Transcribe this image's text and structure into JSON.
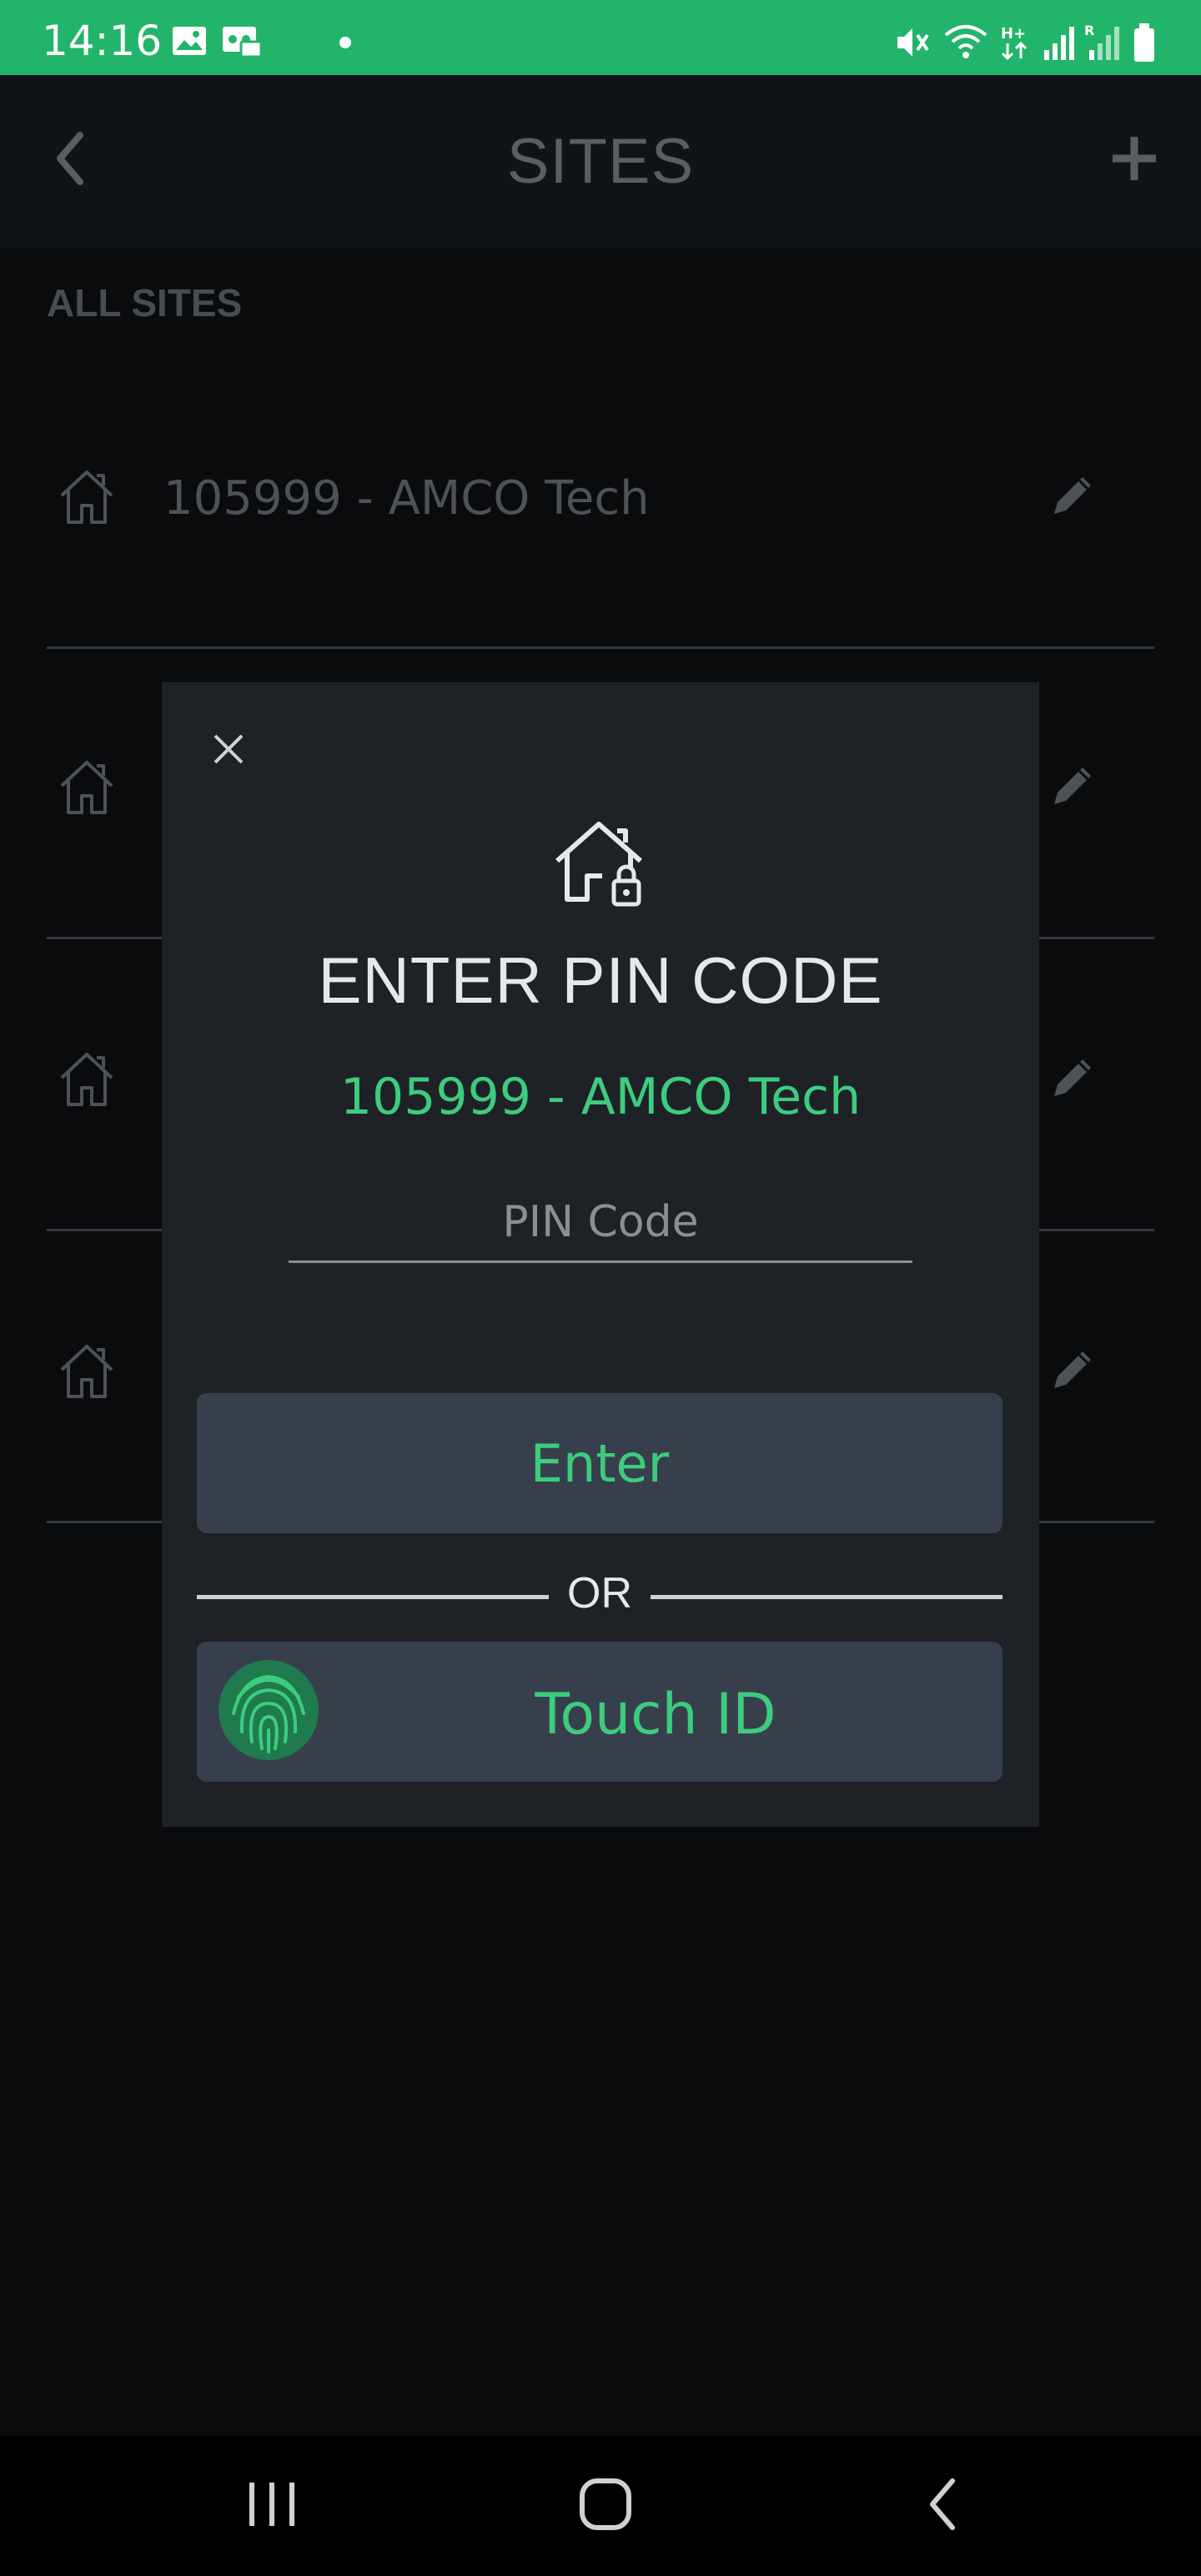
{
  "status_bar": {
    "time": "14:16",
    "icons": [
      "image-icon",
      "voicemail-icon",
      "mute-icon",
      "wifi-icon",
      "hplus-icon",
      "signal-icon",
      "roaming-signal-icon",
      "battery-icon"
    ],
    "bg_color": "#22b46a"
  },
  "header": {
    "title": "SITES",
    "back_icon": "chevron-left-icon",
    "add_icon": "plus-icon"
  },
  "section_label": "ALL SITES",
  "sites": [
    {
      "name": "105999 - AMCO Tech"
    },
    {
      "name": ""
    },
    {
      "name": ""
    },
    {
      "name": ""
    }
  ],
  "modal": {
    "close_icon": "close-icon",
    "icon": "house-lock-icon",
    "heading": "ENTER PIN CODE",
    "site_name": "105999 - AMCO Tech",
    "pin_placeholder": "PIN Code",
    "pin_value": "",
    "enter_label": "Enter",
    "or_label": "OR",
    "touch_id_label": "Touch ID",
    "fingerprint_icon": "fingerprint-icon"
  },
  "colors": {
    "accent": "#3dcc7e",
    "background": "#0f1215",
    "header_bg": "#1a1e24",
    "modal_bg": "#1e2227",
    "button_bg": "#373f4d"
  }
}
